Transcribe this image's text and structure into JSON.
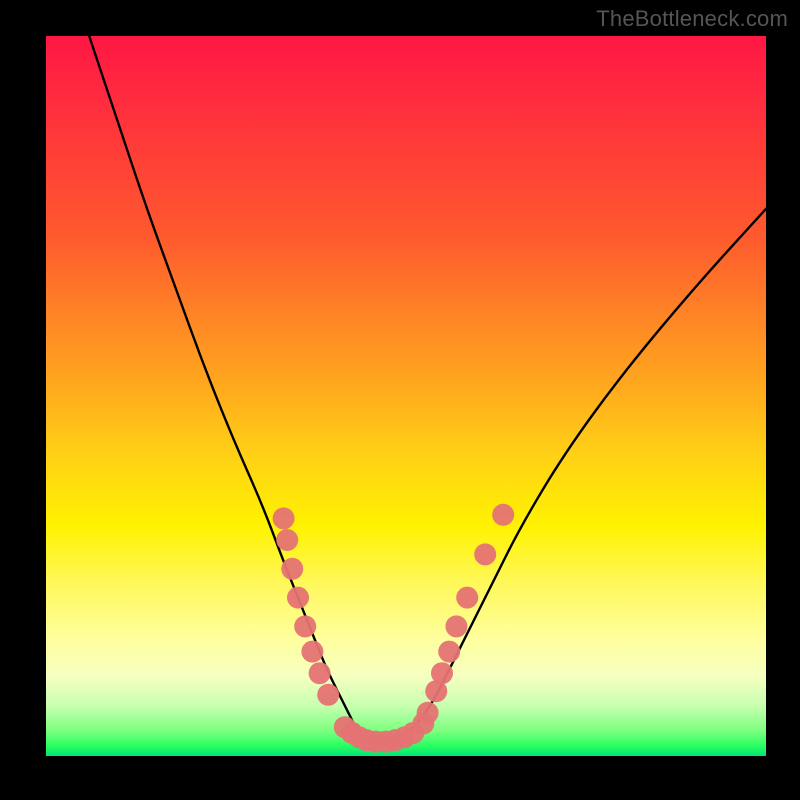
{
  "watermark": "TheBottleneck.com",
  "chart_data": {
    "type": "line",
    "title": "",
    "xlabel": "",
    "ylabel": "",
    "xlim": [
      0,
      100
    ],
    "ylim": [
      0,
      100
    ],
    "grid": false,
    "legend": false,
    "series": [
      {
        "name": "bottleneck-curve",
        "color": "#000000",
        "x": [
          6,
          10,
          14,
          18,
          22,
          26,
          30,
          33,
          35,
          37,
          39,
          41,
          42,
          43,
          44,
          45,
          46,
          48,
          50,
          52,
          54,
          56,
          58,
          62,
          66,
          72,
          80,
          90,
          100
        ],
        "y": [
          100,
          88,
          76,
          65,
          54,
          44,
          35,
          27,
          22,
          17,
          12,
          8,
          6,
          4,
          3,
          2,
          2,
          2,
          3,
          5,
          8,
          12,
          16,
          24,
          32,
          42,
          53,
          65,
          76
        ]
      }
    ],
    "markers": [
      {
        "name": "left-branch-dots",
        "color": "#e57373",
        "points": [
          {
            "x": 33.0,
            "y": 33.0
          },
          {
            "x": 33.5,
            "y": 30.0
          },
          {
            "x": 34.2,
            "y": 26.0
          },
          {
            "x": 35.0,
            "y": 22.0
          },
          {
            "x": 36.0,
            "y": 18.0
          },
          {
            "x": 37.0,
            "y": 14.5
          },
          {
            "x": 38.0,
            "y": 11.5
          },
          {
            "x": 39.2,
            "y": 8.5
          }
        ]
      },
      {
        "name": "valley-dots",
        "color": "#e57373",
        "points": [
          {
            "x": 41.5,
            "y": 4.0
          },
          {
            "x": 42.5,
            "y": 3.2
          },
          {
            "x": 43.5,
            "y": 2.6
          },
          {
            "x": 44.5,
            "y": 2.2
          },
          {
            "x": 45.8,
            "y": 2.0
          },
          {
            "x": 47.2,
            "y": 2.0
          },
          {
            "x": 48.5,
            "y": 2.2
          },
          {
            "x": 49.8,
            "y": 2.6
          },
          {
            "x": 51.0,
            "y": 3.2
          },
          {
            "x": 52.4,
            "y": 4.5
          }
        ]
      },
      {
        "name": "right-branch-dots",
        "color": "#e57373",
        "points": [
          {
            "x": 53.0,
            "y": 6.0
          },
          {
            "x": 54.2,
            "y": 9.0
          },
          {
            "x": 55.0,
            "y": 11.5
          },
          {
            "x": 56.0,
            "y": 14.5
          },
          {
            "x": 57.0,
            "y": 18.0
          },
          {
            "x": 58.5,
            "y": 22.0
          },
          {
            "x": 61.0,
            "y": 28.0
          },
          {
            "x": 63.5,
            "y": 33.5
          }
        ]
      }
    ]
  }
}
